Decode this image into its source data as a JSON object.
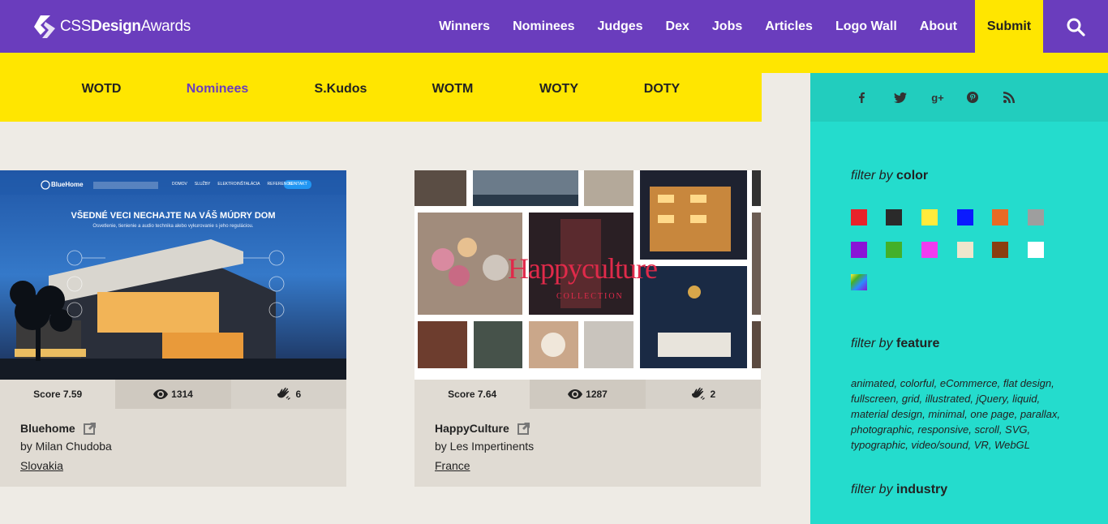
{
  "brand": {
    "name_part1": "CSS",
    "name_part2": "Design",
    "name_part3": "Awards",
    "color": "#6a3dbd",
    "accent": "#ffe600",
    "sidebar": "#24dccd"
  },
  "nav": {
    "items": [
      "Winners",
      "Nominees",
      "Judges",
      "Dex",
      "Jobs",
      "Articles",
      "Logo Wall",
      "About"
    ],
    "submit": "Submit"
  },
  "subnav": {
    "items": [
      "WOTD",
      "Nominees",
      "S.Kudos",
      "WOTM",
      "WOTY",
      "DOTY"
    ],
    "active": "Nominees"
  },
  "social": [
    "f",
    "twitter",
    "g+",
    "pinterest",
    "rss"
  ],
  "filters": {
    "by_word": "filter by",
    "color_label": "color",
    "feature_label": "feature",
    "industry_label": "industry",
    "colors": [
      "#e8222a",
      "#2a2a2a",
      "#ffeb3b",
      "#0a1aff",
      "#e86a24",
      "#9e9e9e",
      "#8a14d6",
      "#43b02a",
      "#f03cf0",
      "#efe6cc",
      "#8a3e10",
      "#ffffff",
      "gradient"
    ],
    "features": "animated, colorful, eCommerce, flat design, fullscreen, grid, illustrated, jQuery, liquid, material design, minimal, one page, parallax, photographic, responsive, scroll, SVG, typographic, video/sound, VR, WebGL"
  },
  "cards": [
    {
      "title": "Bluehome",
      "author": "by Milan Chudoba",
      "country": "Slovakia",
      "score": "Score 7.59",
      "views": "1314",
      "kudos": "6",
      "image_headline": "VŠEDNÉ VECI NECHAJTE NA VÁŠ MÚDRY DOM",
      "image_sub": "Osvetlenie, tienienie a audio technika alebo vykurovanie s jeho reguláciou.",
      "image_brand": "BlueHome",
      "image_nav": [
        "DOMOV",
        "SLUŽBY",
        "ELEKTROINŠTALÁCIA",
        "REFERENCIE"
      ],
      "image_cta": "KONTAKT"
    },
    {
      "title": "HappyCulture",
      "author": "by Les Impertinents",
      "country": "France",
      "score": "Score 7.64",
      "views": "1287",
      "kudos": "2",
      "image_logo_1": "Happy",
      "image_logo_2": "culture",
      "image_sub": "COLLECTION"
    }
  ]
}
